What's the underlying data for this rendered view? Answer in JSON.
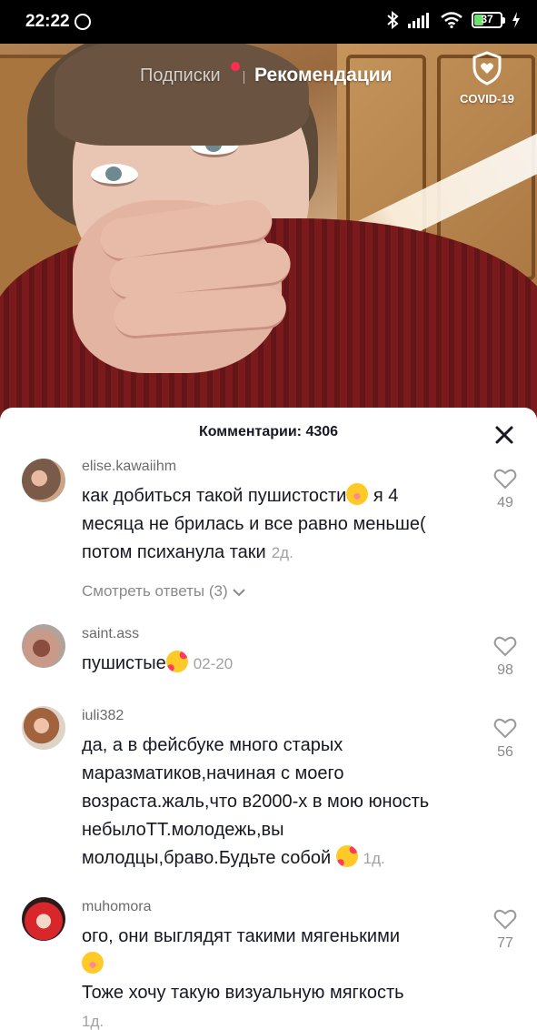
{
  "status_bar": {
    "time": "22:22",
    "battery": "37",
    "battery_level": 0.37,
    "icons": [
      "bluetooth-icon",
      "signal-icon",
      "wifi-icon",
      "charging-icon"
    ]
  },
  "top_tabs": {
    "following": "Подписки",
    "for_you": "Рекомендации",
    "covid_label": "COVID-19"
  },
  "comments_sheet": {
    "title": "Комментарии: 4306",
    "comments": [
      {
        "username": "elise.kawaiihm",
        "text_before_emoji": "как добиться такой пушистости",
        "text_after_emoji": " я 4 месяца не брилась и все равно меньше( потом психанула таки",
        "emoji": "flushed-face-emoji",
        "time": "2д.",
        "likes": "49",
        "view_replies": "Смотреть ответы (3)"
      },
      {
        "username": "saint.ass",
        "text_before_emoji": "пушистые",
        "text_after_emoji": "",
        "emoji": "smiling-face-with-hearts-emoji",
        "time": "02-20",
        "likes": "98"
      },
      {
        "username": "iuli382",
        "text_before_emoji": "да, а в фейсбуке много старых маразматиков,начиная с моего возраста.жаль,что в2000-х в мою юность небылоТТ.молодежь,вы молодцы,браво.Будьте собой ",
        "text_after_emoji": "",
        "emoji": "smiling-face-with-hearts-emoji",
        "time": "1д.",
        "likes": "56"
      },
      {
        "username": "muhomora",
        "text_before_emoji": "ого, они выглядят такими мягенькими",
        "text_line2": "Тоже хочу такую визуальную мягкость",
        "emoji": "flushed-face-emoji",
        "time": "1д.",
        "likes": "77"
      }
    ]
  },
  "colors": {
    "accent_red": "#fe2c55",
    "text_primary": "#161823",
    "text_secondary": "#8a8a8a",
    "battery_green": "#6ee06e"
  }
}
